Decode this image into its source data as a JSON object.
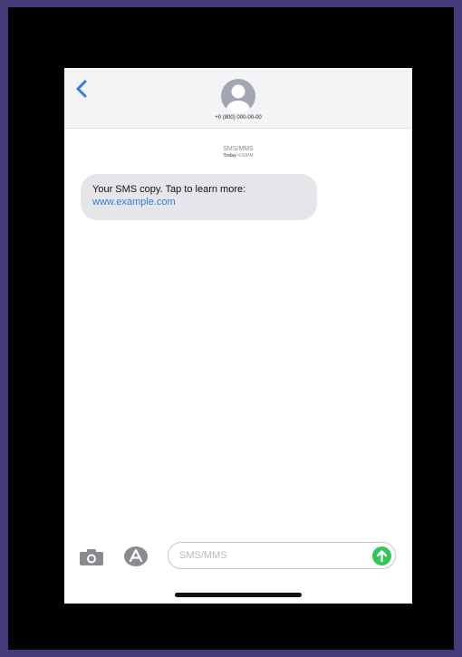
{
  "header": {
    "contact_number": "+0 (800) 000-00-00",
    "back_icon": "chevron-left-icon",
    "avatar_icon": "person-avatar-icon"
  },
  "thread": {
    "service": "SMS/MMS",
    "day": "Today",
    "time": "4:00PM"
  },
  "message": {
    "text": "Your SMS copy. Tap to learn more:",
    "link": "www.example.com"
  },
  "composer": {
    "placeholder": "SMS/MMS",
    "camera_icon": "camera-icon",
    "apps_icon": "app-store-icon",
    "send_icon": "send-arrow-icon"
  },
  "colors": {
    "background": "#433a7a",
    "link": "#2f7de0",
    "send": "#35c659",
    "bubble": "#e6e6ea"
  }
}
